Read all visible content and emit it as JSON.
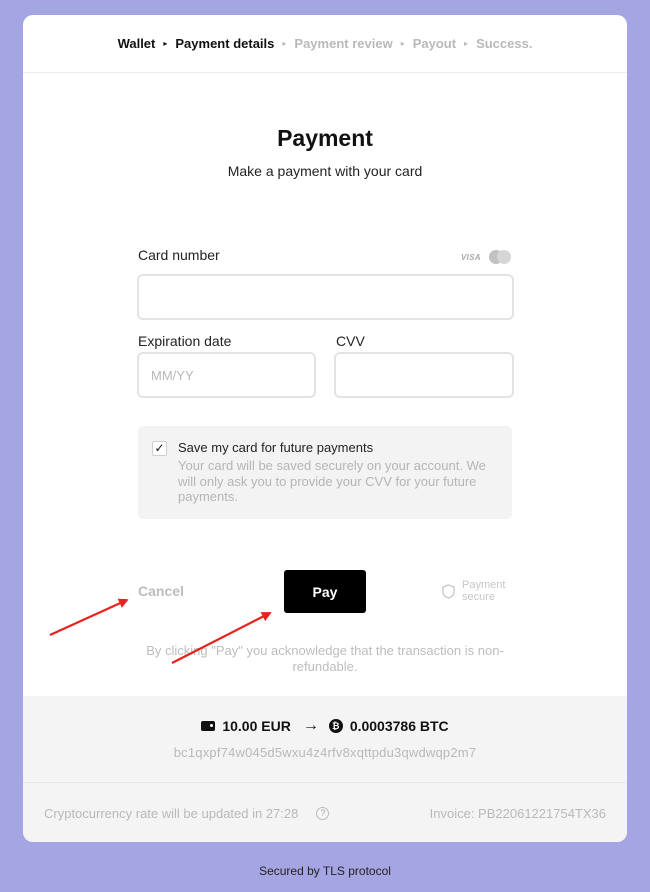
{
  "breadcrumb": {
    "items": [
      {
        "label": "Wallet",
        "active": true
      },
      {
        "label": "Payment details",
        "active": true
      },
      {
        "label": "Payment review",
        "active": false
      },
      {
        "label": "Payout",
        "active": false
      },
      {
        "label": "Success.",
        "active": false
      }
    ],
    "separator": "▸"
  },
  "header": {
    "title": "Payment",
    "subtitle": "Make a payment with your card"
  },
  "form": {
    "card_number_label": "Card number",
    "card_number_value": "",
    "card_brands": {
      "visa": "VISA",
      "mastercard_icon": "mastercard-icon"
    },
    "expiration_label": "Expiration date",
    "expiration_placeholder": "MM/YY",
    "cvv_label": "CVV",
    "cvv_value": ""
  },
  "save_card": {
    "checked": true,
    "check_glyph": "✓",
    "title": "Save my card for future payments",
    "description": "Your card will be saved securely on your account. We will only ask you to provide your CVV for your future payments."
  },
  "actions": {
    "cancel_label": "Cancel",
    "pay_label": "Pay",
    "secure_label": "Payment secure",
    "secure_icon": "shield-icon"
  },
  "acknowledgement": "By clicking \"Pay\" you acknowledge that the transaction is non-refundable.",
  "conversion": {
    "fiat_amount": "10.00 EUR",
    "arrow": "→",
    "crypto_amount": "0.0003786 BTC",
    "btc_glyph": "₿",
    "address": "bc1qxpf74w045d5wxu4z4rfv8xqttpdu3qwdwqp2m7"
  },
  "footer": {
    "rate_text": "Cryptocurrency rate will be updated in 27:28",
    "help_glyph": "?",
    "invoice": "Invoice: PB22061221754TX36"
  },
  "bottom": {
    "tls": "Secured by TLS protocol"
  },
  "colors": {
    "background": "#a5a5e3",
    "pay_button": "#000000",
    "annotation_arrow": "#e8231f"
  }
}
